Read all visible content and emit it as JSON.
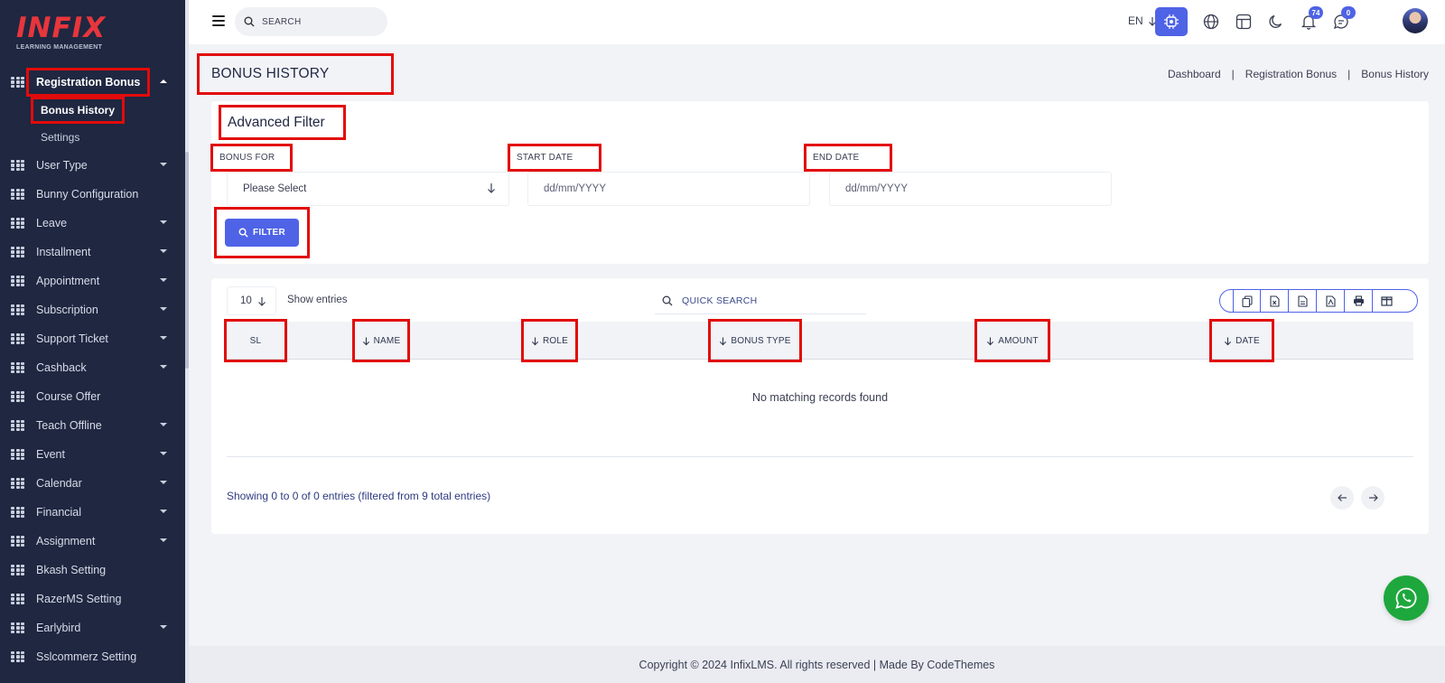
{
  "brand": {
    "logo_text": "INFIX",
    "logo_subtitle": "LEARNING MANAGEMENT"
  },
  "sidebar": {
    "group": {
      "label": "Registration Bonus",
      "icon": "grid-icon"
    },
    "submenu": [
      {
        "label": "Bonus History",
        "active": true
      },
      {
        "label": "Settings",
        "active": false
      }
    ],
    "items": [
      {
        "label": "User Type",
        "has_caret": true
      },
      {
        "label": "Bunny Configuration",
        "has_caret": false
      },
      {
        "label": "Leave",
        "has_caret": true
      },
      {
        "label": "Installment",
        "has_caret": true
      },
      {
        "label": "Appointment",
        "has_caret": true
      },
      {
        "label": "Subscription",
        "has_caret": true
      },
      {
        "label": "Support Ticket",
        "has_caret": true
      },
      {
        "label": "Cashback",
        "has_caret": true
      },
      {
        "label": "Course Offer",
        "has_caret": false
      },
      {
        "label": "Teach Offline",
        "has_caret": true
      },
      {
        "label": "Event",
        "has_caret": true
      },
      {
        "label": "Calendar",
        "has_caret": true
      },
      {
        "label": "Financial",
        "has_caret": true
      },
      {
        "label": "Assignment",
        "has_caret": true
      },
      {
        "label": "Bkash Setting",
        "has_caret": false
      },
      {
        "label": "RazerMS Setting",
        "has_caret": false
      },
      {
        "label": "Earlybird",
        "has_caret": true
      },
      {
        "label": "Sslcommerz Setting",
        "has_caret": false
      }
    ]
  },
  "topbar": {
    "search_placeholder": "SEARCH",
    "language": "EN",
    "notifications_count": "74",
    "messages_count": "0"
  },
  "page": {
    "title": "BONUS HISTORY",
    "breadcrumb": [
      "Dashboard",
      "Registration Bonus",
      "Bonus History"
    ]
  },
  "filter": {
    "title": "Advanced Filter",
    "bonus_for_label": "BONUS FOR",
    "bonus_for_value": "Please Select",
    "start_date_label": "START DATE",
    "start_date_placeholder": "dd/mm/YYYY",
    "end_date_label": "END DATE",
    "end_date_placeholder": "dd/mm/YYYY",
    "button_label": "FILTER"
  },
  "table": {
    "page_size": "10",
    "show_entries_label": "Show entries",
    "quick_search_placeholder": "QUICK SEARCH",
    "export_buttons": [
      "copy-icon",
      "excel-icon",
      "csv-icon",
      "pdf-icon",
      "print-icon",
      "columns-icon"
    ],
    "columns": [
      "SL",
      "NAME",
      "ROLE",
      "BONUS TYPE",
      "AMOUNT",
      "DATE"
    ],
    "rows": [],
    "empty_message": "No matching records found",
    "info": "Showing 0 to 0 of 0 entries (filtered from 9 total entries)"
  },
  "footer": {
    "text": "Copyright © 2024 InfixLMS. All rights reserved | Made By CodeThemes"
  },
  "colors": {
    "accent": "#4e63e6",
    "sidebar_bg": "#1f2741",
    "brand_red": "#e7363c",
    "whatsapp": "#1ea73d",
    "highlight": "#e20b0b"
  }
}
